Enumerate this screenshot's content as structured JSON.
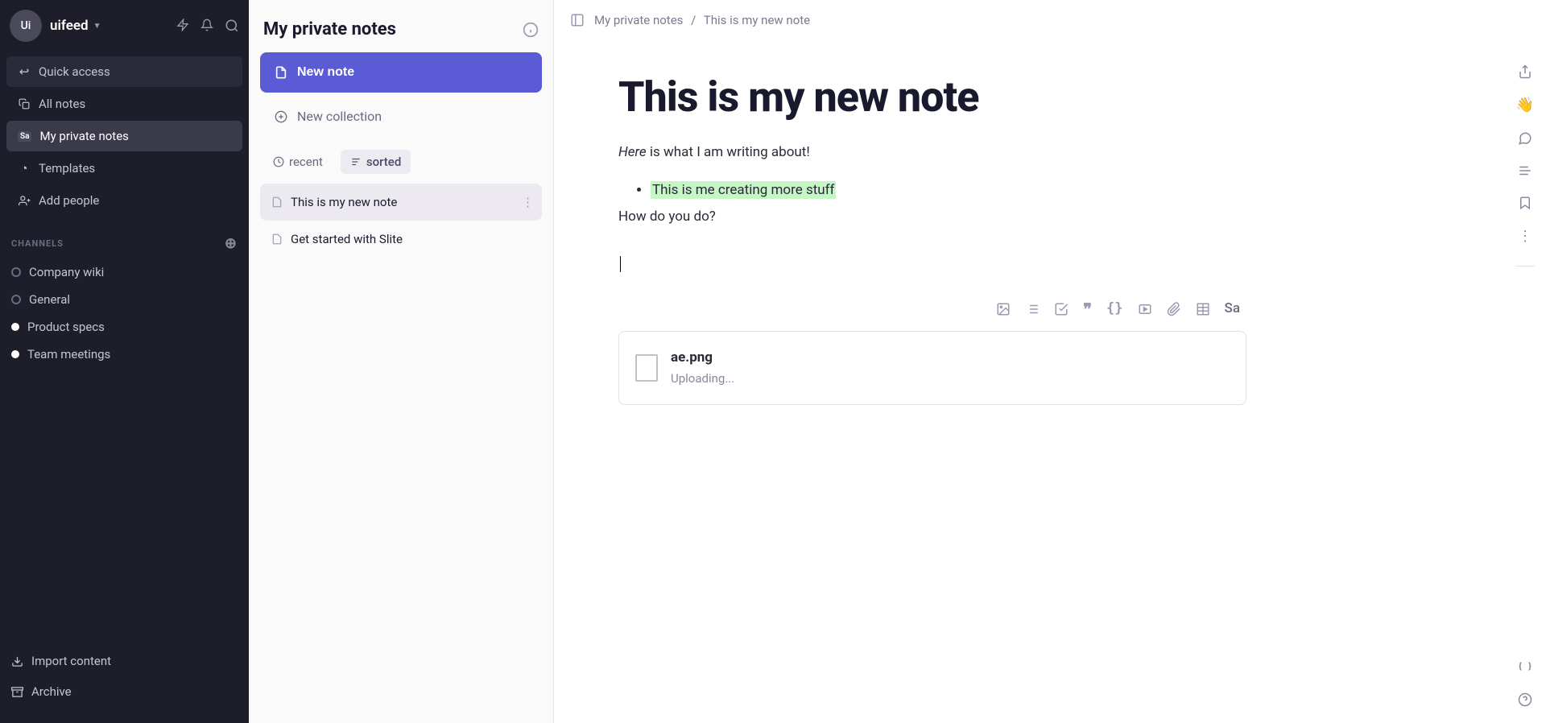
{
  "workspace": {
    "avatar_initials": "Ui",
    "name": "uifeed"
  },
  "sidebar": {
    "quick_access": "Quick access",
    "all_notes": "All notes",
    "private_notes": "My private notes",
    "private_badge": "Sa",
    "templates": "Templates",
    "add_people": "Add people",
    "channels_header": "CHANNELS",
    "channels": [
      {
        "label": "Company wiki",
        "filled": false
      },
      {
        "label": "General",
        "filled": false
      },
      {
        "label": "Product specs",
        "filled": true
      },
      {
        "label": "Team meetings",
        "filled": true
      }
    ],
    "import": "Import content",
    "archive": "Archive"
  },
  "panel": {
    "title": "My private notes",
    "new_note": "New note",
    "new_collection": "New collection",
    "recent_label": "recent",
    "sorted_label": "sorted",
    "notes": [
      {
        "title": "This is my new note",
        "selected": true
      },
      {
        "title": "Get started with Slite",
        "selected": false
      }
    ]
  },
  "breadcrumb": {
    "parent": "My private notes",
    "sep": "/",
    "current": "This is my new note"
  },
  "document": {
    "title": "This is my new note",
    "intro_em": "Here",
    "intro_rest": " is what I am writing about!",
    "bullet_highlight": "This is me creating more stuff",
    "line2": "How do you do?"
  },
  "attachment": {
    "filename": "ae.png",
    "status": "Uploading..."
  },
  "float_toolbar": {
    "sa": "Sa"
  }
}
